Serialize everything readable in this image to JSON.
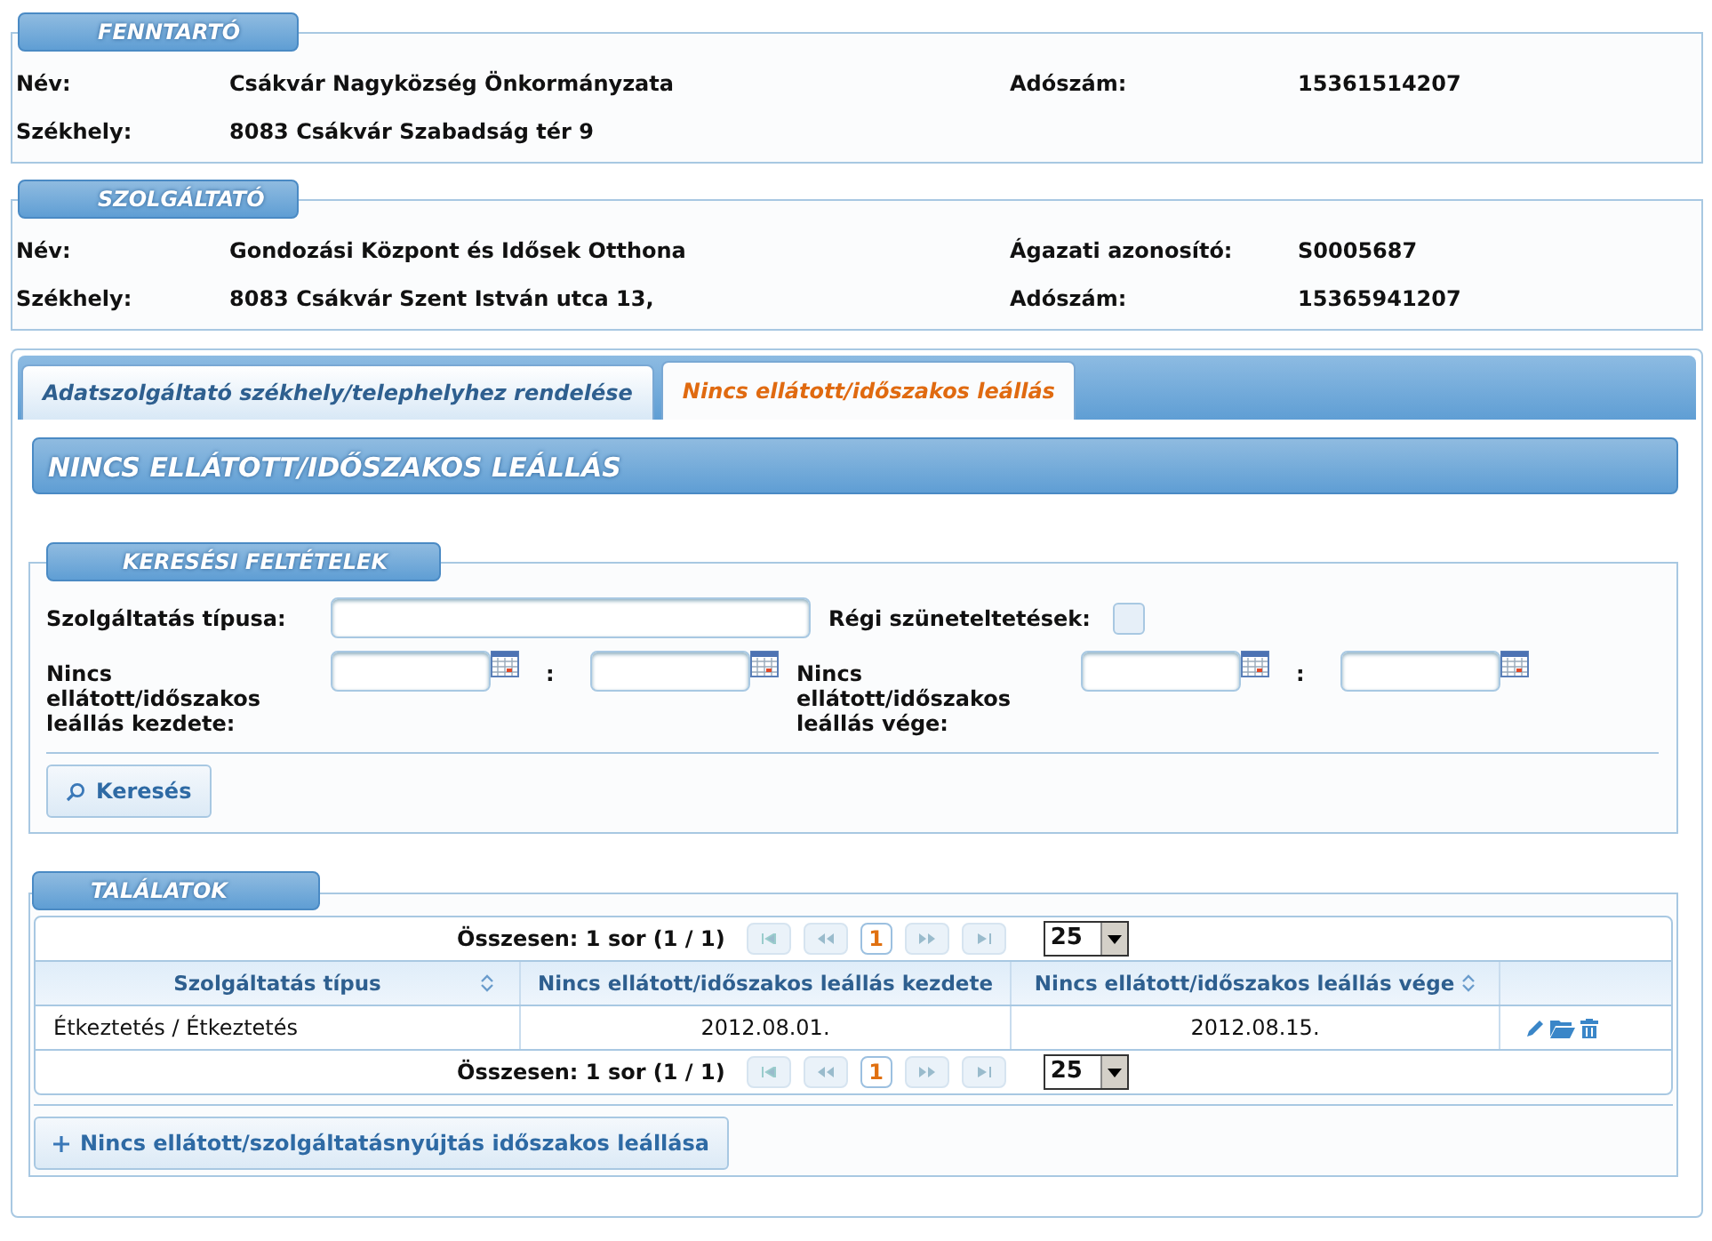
{
  "fenntarto": {
    "title": "FENNTARTÓ",
    "rows": [
      {
        "cells": [
          {
            "label": "Név:",
            "value": "Csákvár Nagyközség Önkormányzata"
          },
          {
            "label": "Adószám:",
            "value": "15361514207"
          }
        ]
      },
      {
        "cells": [
          {
            "label": "Székhely:",
            "value": "8083 Csákvár Szabadság tér 9"
          }
        ]
      }
    ]
  },
  "szolgaltato": {
    "title": "SZOLGÁLTATÓ",
    "rows": [
      {
        "cells": [
          {
            "label": "Név:",
            "value": "Gondozási Központ és Idősek Otthona"
          },
          {
            "label": "Ágazati azonosító:",
            "value": "S0005687"
          }
        ]
      },
      {
        "cells": [
          {
            "label": "Székhely:",
            "value": "8083 Csákvár Szent István utca 13,"
          },
          {
            "label": "Adószám:",
            "value": "15365941207"
          }
        ]
      }
    ]
  },
  "tabs": [
    {
      "label": "Adatszolgáltató székhely/telephelyhez rendelése",
      "selected": false
    },
    {
      "label": "Nincs ellátott/időszakos leállás",
      "selected": true
    }
  ],
  "page_heading": "NINCS ELLÁTOTT/IDŐSZAKOS LEÁLLÁS",
  "search": {
    "title": "KERESÉSI FELTÉTELEK",
    "service_type_label": "Szolgáltatás típusa:",
    "old_label": "Régi szüneteltetések:",
    "old_checked": false,
    "start_label": "Nincs ellátott/időszakos leállás kezdete:",
    "end_label": "Nincs ellátott/időszakos leállás vége:",
    "range_separator": ":",
    "button": "Keresés"
  },
  "results": {
    "title": "TALÁLATOK",
    "pagers": [
      {
        "summary": "Összesen: 1 sor (1 / 1)",
        "pages": [
          {
            "label": "1",
            "selected": true
          }
        ],
        "page_size": "25"
      },
      {
        "summary": "Összesen: 1 sor (1 / 1)",
        "pages": [
          {
            "label": "1",
            "selected": true
          }
        ],
        "page_size": "25"
      }
    ],
    "columns": [
      {
        "label": "Szolgáltatás típus",
        "sortable": true
      },
      {
        "label": "Nincs ellátott/időszakos leállás kezdete",
        "sortable": false
      },
      {
        "label": "Nincs ellátott/időszakos leállás vége",
        "sortable": true
      }
    ],
    "rows": [
      {
        "cells": [
          "Étkeztetés / Étkeztetés",
          "2012.08.01.",
          "2012.08.15."
        ]
      }
    ],
    "add_button": "Nincs ellátott/szolgáltatásnyújtás időszakos leállása"
  }
}
